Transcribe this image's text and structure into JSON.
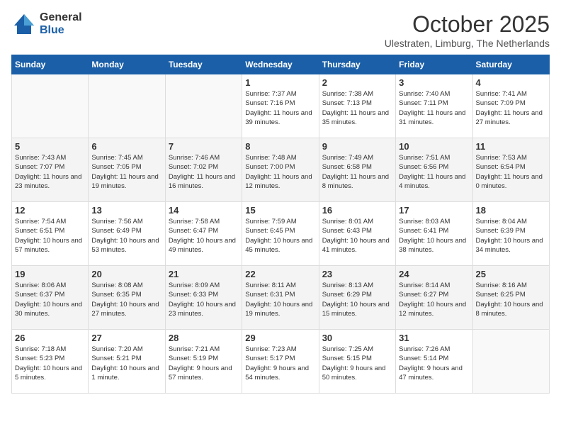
{
  "logo": {
    "general": "General",
    "blue": "Blue"
  },
  "title": "October 2025",
  "location": "Ulestraten, Limburg, The Netherlands",
  "weekdays": [
    "Sunday",
    "Monday",
    "Tuesday",
    "Wednesday",
    "Thursday",
    "Friday",
    "Saturday"
  ],
  "weeks": [
    [
      {
        "day": "",
        "info": ""
      },
      {
        "day": "",
        "info": ""
      },
      {
        "day": "",
        "info": ""
      },
      {
        "day": "1",
        "info": "Sunrise: 7:37 AM\nSunset: 7:16 PM\nDaylight: 11 hours and 39 minutes."
      },
      {
        "day": "2",
        "info": "Sunrise: 7:38 AM\nSunset: 7:13 PM\nDaylight: 11 hours and 35 minutes."
      },
      {
        "day": "3",
        "info": "Sunrise: 7:40 AM\nSunset: 7:11 PM\nDaylight: 11 hours and 31 minutes."
      },
      {
        "day": "4",
        "info": "Sunrise: 7:41 AM\nSunset: 7:09 PM\nDaylight: 11 hours and 27 minutes."
      }
    ],
    [
      {
        "day": "5",
        "info": "Sunrise: 7:43 AM\nSunset: 7:07 PM\nDaylight: 11 hours and 23 minutes."
      },
      {
        "day": "6",
        "info": "Sunrise: 7:45 AM\nSunset: 7:05 PM\nDaylight: 11 hours and 19 minutes."
      },
      {
        "day": "7",
        "info": "Sunrise: 7:46 AM\nSunset: 7:02 PM\nDaylight: 11 hours and 16 minutes."
      },
      {
        "day": "8",
        "info": "Sunrise: 7:48 AM\nSunset: 7:00 PM\nDaylight: 11 hours and 12 minutes."
      },
      {
        "day": "9",
        "info": "Sunrise: 7:49 AM\nSunset: 6:58 PM\nDaylight: 11 hours and 8 minutes."
      },
      {
        "day": "10",
        "info": "Sunrise: 7:51 AM\nSunset: 6:56 PM\nDaylight: 11 hours and 4 minutes."
      },
      {
        "day": "11",
        "info": "Sunrise: 7:53 AM\nSunset: 6:54 PM\nDaylight: 11 hours and 0 minutes."
      }
    ],
    [
      {
        "day": "12",
        "info": "Sunrise: 7:54 AM\nSunset: 6:51 PM\nDaylight: 10 hours and 57 minutes."
      },
      {
        "day": "13",
        "info": "Sunrise: 7:56 AM\nSunset: 6:49 PM\nDaylight: 10 hours and 53 minutes."
      },
      {
        "day": "14",
        "info": "Sunrise: 7:58 AM\nSunset: 6:47 PM\nDaylight: 10 hours and 49 minutes."
      },
      {
        "day": "15",
        "info": "Sunrise: 7:59 AM\nSunset: 6:45 PM\nDaylight: 10 hours and 45 minutes."
      },
      {
        "day": "16",
        "info": "Sunrise: 8:01 AM\nSunset: 6:43 PM\nDaylight: 10 hours and 41 minutes."
      },
      {
        "day": "17",
        "info": "Sunrise: 8:03 AM\nSunset: 6:41 PM\nDaylight: 10 hours and 38 minutes."
      },
      {
        "day": "18",
        "info": "Sunrise: 8:04 AM\nSunset: 6:39 PM\nDaylight: 10 hours and 34 minutes."
      }
    ],
    [
      {
        "day": "19",
        "info": "Sunrise: 8:06 AM\nSunset: 6:37 PM\nDaylight: 10 hours and 30 minutes."
      },
      {
        "day": "20",
        "info": "Sunrise: 8:08 AM\nSunset: 6:35 PM\nDaylight: 10 hours and 27 minutes."
      },
      {
        "day": "21",
        "info": "Sunrise: 8:09 AM\nSunset: 6:33 PM\nDaylight: 10 hours and 23 minutes."
      },
      {
        "day": "22",
        "info": "Sunrise: 8:11 AM\nSunset: 6:31 PM\nDaylight: 10 hours and 19 minutes."
      },
      {
        "day": "23",
        "info": "Sunrise: 8:13 AM\nSunset: 6:29 PM\nDaylight: 10 hours and 15 minutes."
      },
      {
        "day": "24",
        "info": "Sunrise: 8:14 AM\nSunset: 6:27 PM\nDaylight: 10 hours and 12 minutes."
      },
      {
        "day": "25",
        "info": "Sunrise: 8:16 AM\nSunset: 6:25 PM\nDaylight: 10 hours and 8 minutes."
      }
    ],
    [
      {
        "day": "26",
        "info": "Sunrise: 7:18 AM\nSunset: 5:23 PM\nDaylight: 10 hours and 5 minutes."
      },
      {
        "day": "27",
        "info": "Sunrise: 7:20 AM\nSunset: 5:21 PM\nDaylight: 10 hours and 1 minute."
      },
      {
        "day": "28",
        "info": "Sunrise: 7:21 AM\nSunset: 5:19 PM\nDaylight: 9 hours and 57 minutes."
      },
      {
        "day": "29",
        "info": "Sunrise: 7:23 AM\nSunset: 5:17 PM\nDaylight: 9 hours and 54 minutes."
      },
      {
        "day": "30",
        "info": "Sunrise: 7:25 AM\nSunset: 5:15 PM\nDaylight: 9 hours and 50 minutes."
      },
      {
        "day": "31",
        "info": "Sunrise: 7:26 AM\nSunset: 5:14 PM\nDaylight: 9 hours and 47 minutes."
      },
      {
        "day": "",
        "info": ""
      }
    ]
  ]
}
